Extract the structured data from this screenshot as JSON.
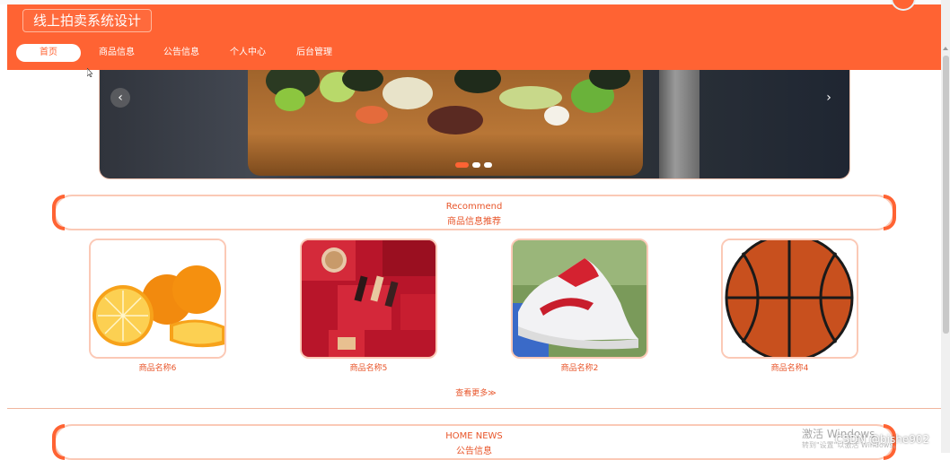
{
  "header": {
    "site_title": "线上拍卖系统设计"
  },
  "nav": {
    "items": [
      {
        "label": "首页",
        "active": true
      },
      {
        "label": "商品信息",
        "active": false
      },
      {
        "label": "公告信息",
        "active": false
      },
      {
        "label": "个人中心",
        "active": false
      },
      {
        "label": "后台管理",
        "active": false
      }
    ]
  },
  "banner": {
    "prev_icon": "‹",
    "next_icon": "›",
    "slide_count": 3,
    "active_slide": 1
  },
  "recommend": {
    "title_en": "Recommend",
    "title_cn": "商品信息推荐",
    "products": [
      {
        "name": "商品名称6",
        "image": "oranges"
      },
      {
        "name": "商品名称5",
        "image": "cosmetics-gift-set"
      },
      {
        "name": "商品名称2",
        "image": "white-sneaker"
      },
      {
        "name": "商品名称4",
        "image": "basketball"
      }
    ],
    "more_label": "查看更多≫"
  },
  "news": {
    "title_en": "HOME NEWS",
    "title_cn": "公告信息"
  },
  "overlay": {
    "activate_windows": "激活 Windows",
    "activate_sub": "转到\"设置\"以激活 Windows。",
    "csdn_watermark": "CSDN @bishe902"
  },
  "colors": {
    "primary": "#ff6333",
    "border": "#fbc9b6"
  }
}
